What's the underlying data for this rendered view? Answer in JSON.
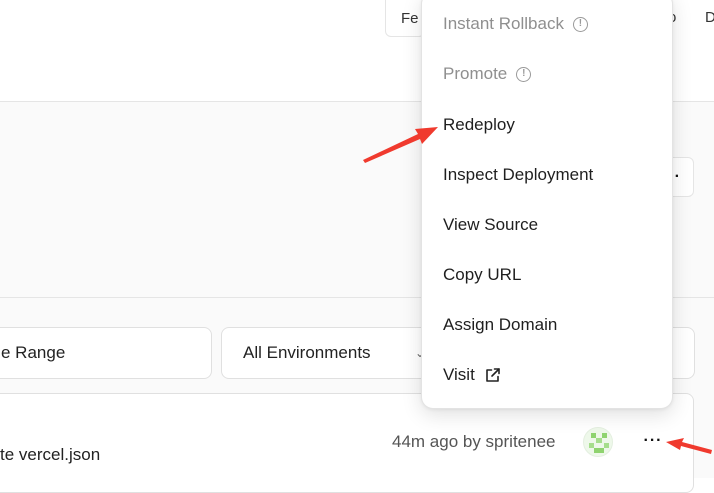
{
  "header": {
    "button_partial": "Fe",
    "right_partial_1": "o",
    "right_partial_2": "D"
  },
  "toolbar": {
    "more_label": "···"
  },
  "filters": {
    "date_range": "e Range",
    "environment": "All Environments"
  },
  "deployment": {
    "commit": "te vercel.json",
    "meta": "44m ago by spritenee",
    "more_label": "···"
  },
  "menu": {
    "items": [
      {
        "label": "Instant Rollback",
        "disabled": true,
        "icon": "info-icon"
      },
      {
        "label": "Promote",
        "disabled": true,
        "icon": "info-icon"
      },
      {
        "label": "Redeploy",
        "disabled": false
      },
      {
        "label": "Inspect Deployment",
        "disabled": false
      },
      {
        "label": "View Source",
        "disabled": false
      },
      {
        "label": "Copy URL",
        "disabled": false
      },
      {
        "label": "Assign Domain",
        "disabled": false
      },
      {
        "label": "Visit",
        "disabled": false,
        "icon": "external-link-icon"
      }
    ]
  },
  "colors": {
    "annotation_arrow": "#f03a2e",
    "disabled_text": "#8f8f8f",
    "avatar_green": "#8fd36f"
  }
}
